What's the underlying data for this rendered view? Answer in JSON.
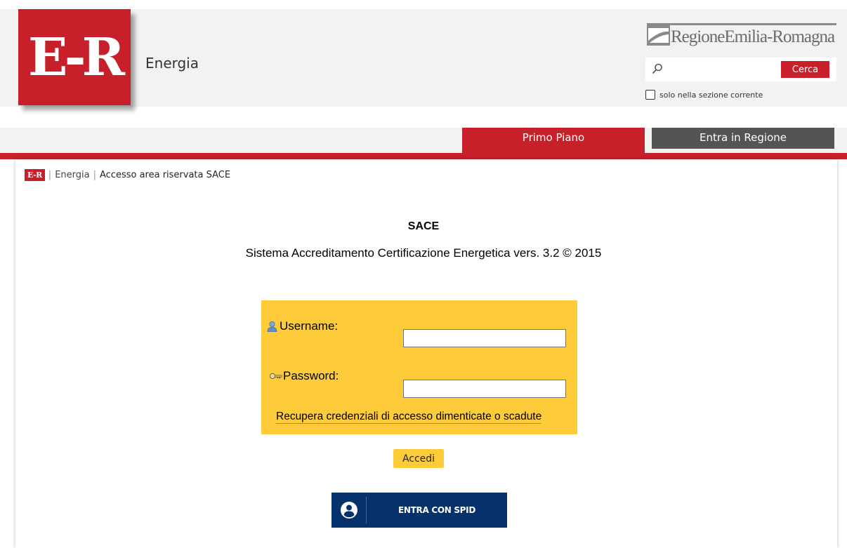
{
  "header": {
    "logo_text": "E-R",
    "site_title": "Energia",
    "region_name": "RegioneEmilia-Romagna",
    "search": {
      "placeholder": "",
      "button_label": "Cerca",
      "section_only_label": "solo nella sezione corrente"
    }
  },
  "nav": {
    "tabs": [
      {
        "label": "Primo Piano",
        "active": true
      },
      {
        "label": "Entra in Regione",
        "active": false
      }
    ]
  },
  "breadcrumb": {
    "home_label": "E-R",
    "items": [
      "Energia",
      "Accesso area riservata SACE"
    ]
  },
  "main": {
    "title": "SACE",
    "subtitle": "Sistema Accreditamento Certificazione Energetica vers. 3.2 © 2015",
    "login": {
      "username_label": "Username:",
      "username_value": "",
      "password_label": "Password:",
      "password_value": "",
      "recover_link": "Recupera credenziali di accesso dimenticate o scadute",
      "submit_label": "Accedi"
    },
    "spid_label": "ENTRA CON SPID"
  },
  "colors": {
    "brand_red": "#c8202a",
    "login_yellow": "#fecb3b",
    "spid_blue": "#06326b",
    "nav_gray": "#545454",
    "header_bg": "#f2f2f2"
  },
  "icons": {
    "search": "search-icon",
    "user": "user-icon",
    "key": "key-icon",
    "spid": "spid-user-icon"
  }
}
